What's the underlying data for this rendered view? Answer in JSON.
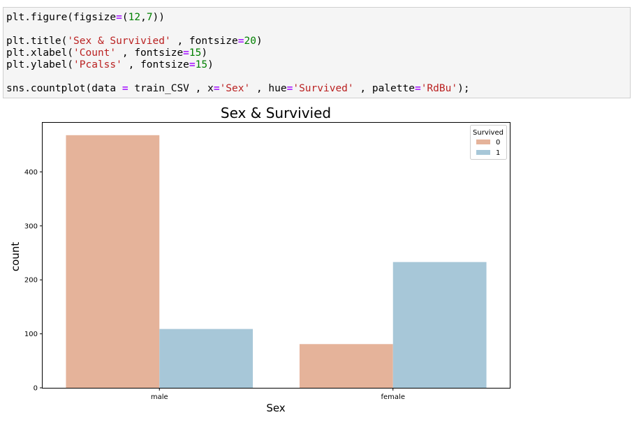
{
  "code_cell": {
    "lines": [
      [
        {
          "t": "plt.figure(figsize"
        },
        {
          "t": "=",
          "c": "op"
        },
        {
          "t": "("
        },
        {
          "t": "12",
          "c": "num"
        },
        {
          "t": ","
        },
        {
          "t": "7",
          "c": "num"
        },
        {
          "t": "))"
        }
      ],
      [],
      [
        {
          "t": "plt.title("
        },
        {
          "t": "'Sex & Survivied'",
          "c": "str"
        },
        {
          "t": " , fontsize"
        },
        {
          "t": "=",
          "c": "op"
        },
        {
          "t": "20",
          "c": "num"
        },
        {
          "t": ")"
        }
      ],
      [
        {
          "t": "plt.xlabel("
        },
        {
          "t": "'Count'",
          "c": "str"
        },
        {
          "t": " , fontsize"
        },
        {
          "t": "=",
          "c": "op"
        },
        {
          "t": "15",
          "c": "num"
        },
        {
          "t": ")"
        }
      ],
      [
        {
          "t": "plt.ylabel("
        },
        {
          "t": "'Pcalss'",
          "c": "str"
        },
        {
          "t": " , fontsize"
        },
        {
          "t": "=",
          "c": "op"
        },
        {
          "t": "15",
          "c": "num"
        },
        {
          "t": ")"
        }
      ],
      [],
      [
        {
          "t": "sns.countplot(data "
        },
        {
          "t": "=",
          "c": "op"
        },
        {
          "t": " train_CSV , x"
        },
        {
          "t": "=",
          "c": "op"
        },
        {
          "t": "'Sex'",
          "c": "str"
        },
        {
          "t": " , hue"
        },
        {
          "t": "=",
          "c": "op"
        },
        {
          "t": "'Survived'",
          "c": "str"
        },
        {
          "t": " , palette"
        },
        {
          "t": "=",
          "c": "op"
        },
        {
          "t": "'RdBu'",
          "c": "str"
        },
        {
          "t": ");"
        }
      ]
    ]
  },
  "chart_data": {
    "type": "bar",
    "title": "Sex & Survivied",
    "xlabel": "Sex",
    "ylabel": "count",
    "categories": [
      "male",
      "female"
    ],
    "series": [
      {
        "name": "0",
        "values": [
          468,
          81
        ],
        "color": "#e5b39a"
      },
      {
        "name": "1",
        "values": [
          109,
          233
        ],
        "color": "#a7c7d8"
      }
    ],
    "ylim": [
      0,
      491
    ],
    "yticks": [
      0,
      100,
      200,
      300,
      400
    ],
    "legend": {
      "title": "Survived",
      "position": "top-right"
    },
    "grid": false
  }
}
